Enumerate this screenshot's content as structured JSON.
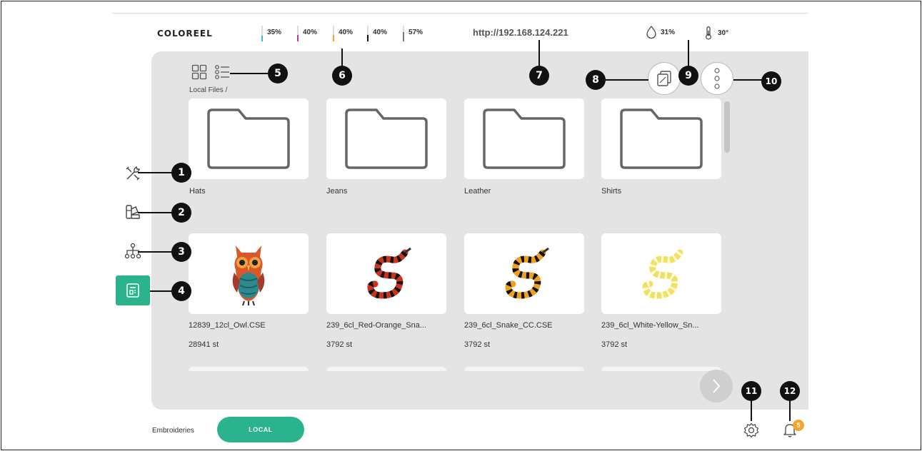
{
  "app": {
    "logo": "COLOREEL",
    "url": "http://192.168.124.221",
    "humidity": "31%",
    "temperature": "30°"
  },
  "inks": [
    {
      "value": "35%",
      "level": 0.35,
      "color": "#39b8d8"
    },
    {
      "value": "40%",
      "level": 0.4,
      "color": "#c0389a"
    },
    {
      "value": "40%",
      "level": 0.4,
      "color": "#f4a52a"
    },
    {
      "value": "40%",
      "level": 0.4,
      "color": "#111111"
    },
    {
      "value": "57%",
      "level": 0.57,
      "color": "#777777"
    }
  ],
  "breadcrumb": "Local Files /",
  "folders": [
    {
      "label": "Hats"
    },
    {
      "label": "Jeans"
    },
    {
      "label": "Leather"
    },
    {
      "label": "Shirts"
    }
  ],
  "files": [
    {
      "name": "12839_12cl_Owl.CSE",
      "stitches": "28941 st",
      "icon": "owl-thumbnail"
    },
    {
      "name": "239_6cl_Red-Orange_Sna...",
      "stitches": "3792 st",
      "icon": "red-snake-thumbnail"
    },
    {
      "name": "239_6cl_Snake_CC.CSE",
      "stitches": "3792 st",
      "icon": "orange-snake-thumbnail"
    },
    {
      "name": "239_6cl_White-Yellow_Sn...",
      "stitches": "3792 st",
      "icon": "yellow-snake-thumbnail"
    }
  ],
  "bottom": {
    "section_label": "Embroideries",
    "local_button": "LOCAL",
    "notification_count": "5"
  },
  "callouts": [
    "1",
    "2",
    "3",
    "4",
    "5",
    "6",
    "7",
    "8",
    "9",
    "10",
    "11",
    "12"
  ],
  "colors": {
    "accent": "#2bb38e",
    "panel": "#e4e4e4",
    "badge": "#f4a52a"
  }
}
